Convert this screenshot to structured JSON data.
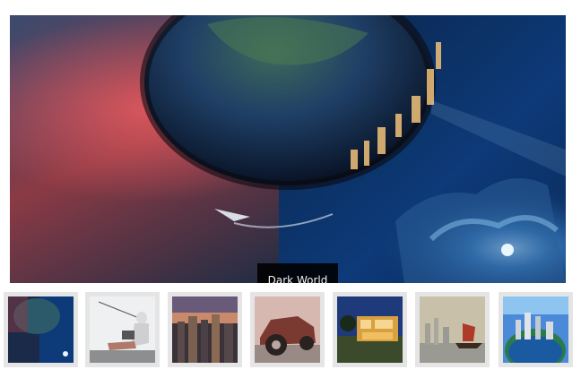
{
  "slider": {
    "caption": "Dark World",
    "active_index": 0,
    "thumbnails": [
      {
        "name": "dark-world-planet"
      },
      {
        "name": "person-with-laptop"
      },
      {
        "name": "city-skyline-sunset"
      },
      {
        "name": "vintage-car"
      },
      {
        "name": "modern-house-night"
      },
      {
        "name": "harbor-junk-boat"
      },
      {
        "name": "city-on-globe"
      }
    ]
  },
  "colors": {
    "thumb_frame": "#e5e5e5",
    "caption_bg": "#000000",
    "caption_text": "#f2f2f2"
  }
}
